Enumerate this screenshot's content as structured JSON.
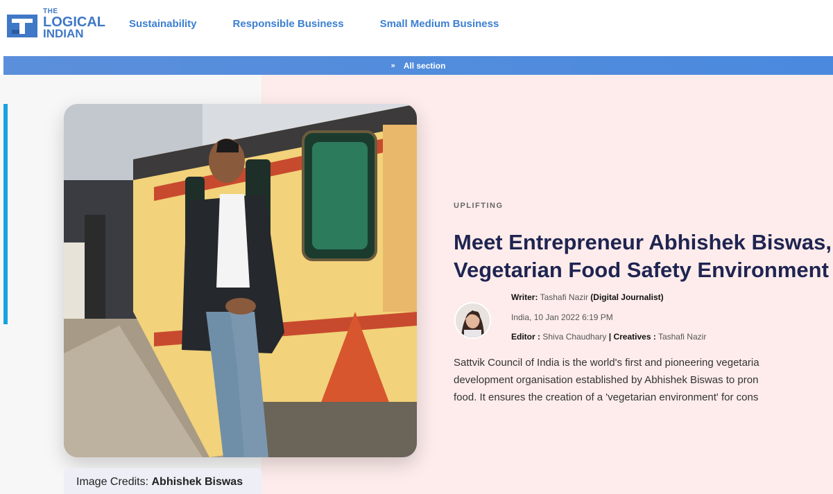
{
  "brand": {
    "logo_line1": "THE",
    "logo_line2": "LOGICAL",
    "logo_line3": "INDIAN"
  },
  "nav": {
    "items": [
      "Sustainability",
      "Responsible Business",
      "Small Medium Business"
    ]
  },
  "section_bar": {
    "label": "All section",
    "icon": "double-chevron-down-icon"
  },
  "hero": {
    "image_subject": "man standing beside decorated train at platform",
    "credit_prefix": "Image Credits:",
    "credit_name": "Abhishek Biswas"
  },
  "article": {
    "category": "UPLIFTING",
    "headline_line1": "Meet Entrepreneur Abhishek Biswas, '",
    "headline_line2": "Vegetarian Food Safety Environment A",
    "writer_label": "Writer:",
    "writer_name": "Tashafi Nazir",
    "writer_role": "(Digital Journalist)",
    "location_date": "India,  10 Jan 2022 6:19 PM",
    "editor_label": "Editor :",
    "editor_name": "Shiva Chaudhary",
    "separator": "|",
    "creatives_label": "Creatives :",
    "creatives_name": "Tashafi Nazir",
    "summary_line1": "Sattvik Council of India is the world's first and pioneering vegetaria",
    "summary_line2": "development organisation established by Abhishek Biswas to pron",
    "summary_line3": "food. It ensures the creation of a 'vegetarian environment' for cons"
  },
  "colors": {
    "brand_blue": "#3b7fd1",
    "headline": "#1f2451",
    "right_bg": "#fdeceb",
    "accent_bar": "#17a2e0"
  }
}
